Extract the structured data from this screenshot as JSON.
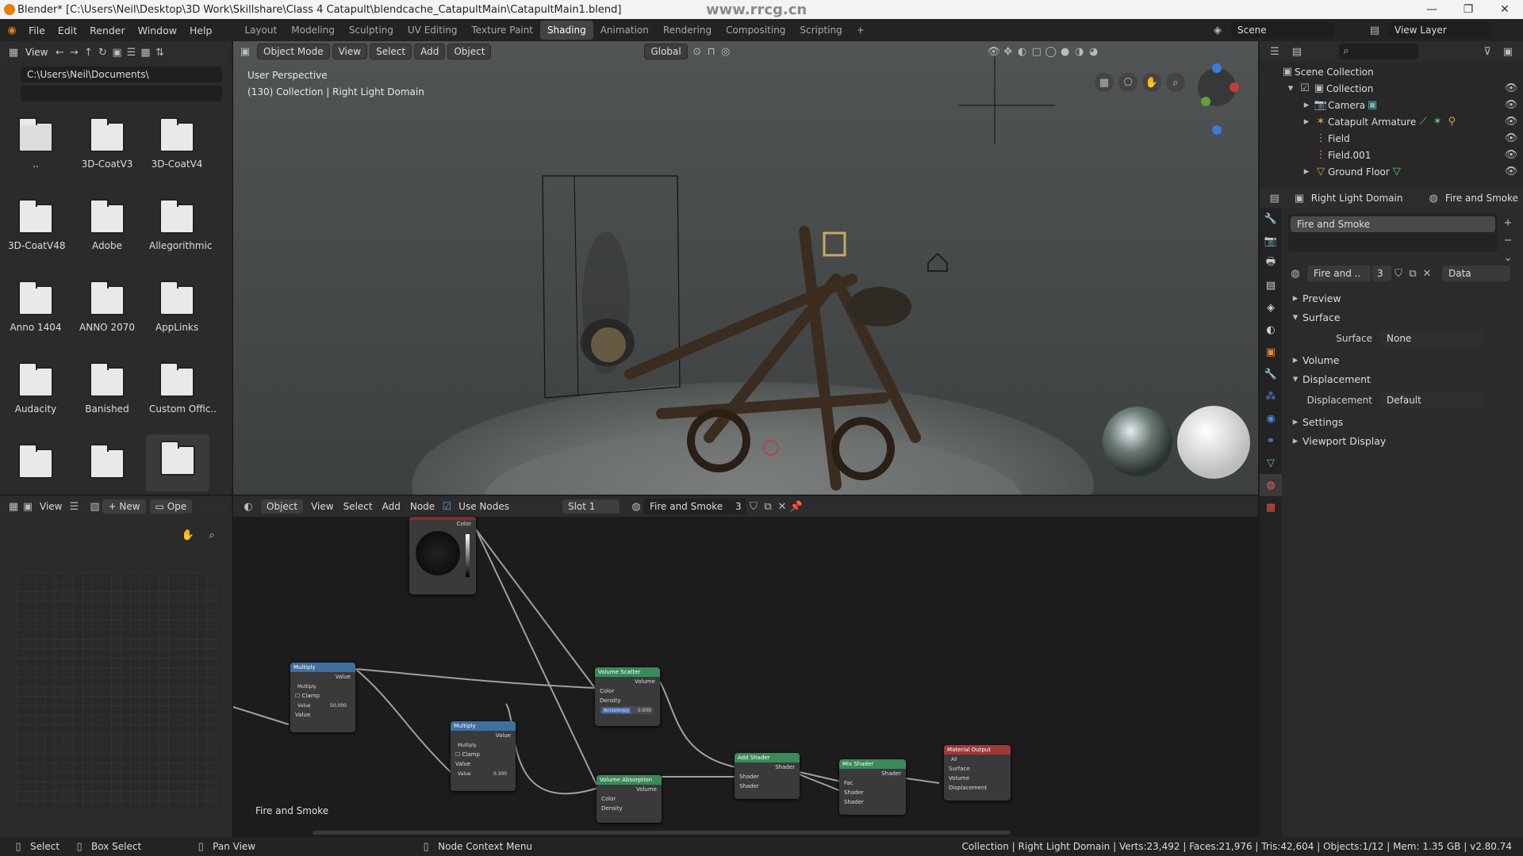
{
  "window": {
    "title": "Blender* [C:\\Users\\Neil\\Desktop\\3D Work\\Skillshare\\Class 4 Catapult\\blendcache_CatapultMain\\CatapultMain1.blend]",
    "watermark": "www.rrcg.cn"
  },
  "menu": {
    "items": [
      "File",
      "Edit",
      "Render",
      "Window",
      "Help"
    ]
  },
  "workspaces": {
    "tabs": [
      "Layout",
      "Modeling",
      "Sculpting",
      "UV Editing",
      "Texture Paint",
      "Shading",
      "Animation",
      "Rendering",
      "Compositing",
      "Scripting"
    ],
    "active": "Shading",
    "add": "+"
  },
  "topright": {
    "scene": "Scene",
    "view_layer": "View Layer"
  },
  "filebrowser": {
    "view": "View",
    "path": "C:\\Users\\Neil\\Documents\\",
    "folders": [
      "..",
      "3D-CoatV3",
      "3D-CoatV4",
      "3D-CoatV48",
      "Adobe",
      "Allegorithmic",
      "Anno 1404",
      "ANNO 2070",
      "AppLinks",
      "Audacity",
      "Banished",
      "Custom Offic..",
      "",
      "",
      ""
    ]
  },
  "viewport": {
    "mode": "Object Mode",
    "menus": [
      "View",
      "Select",
      "Add",
      "Object"
    ],
    "transform": "Global",
    "info_line1": "User Perspective",
    "info_line2": "(130) Collection | Right Light Domain"
  },
  "outliner": {
    "root": "Scene Collection",
    "items": [
      {
        "name": "Collection",
        "indent": 1
      },
      {
        "name": "Camera",
        "indent": 2
      },
      {
        "name": "Catapult Armature",
        "indent": 2
      },
      {
        "name": "Field",
        "indent": 2
      },
      {
        "name": "Field.001",
        "indent": 2
      },
      {
        "name": "Ground Floor",
        "indent": 2
      }
    ]
  },
  "properties": {
    "object": "Right Light Domain",
    "material": "Fire and Smoke",
    "slot_name": "Fire and Smoke",
    "mat_short": "Fire and ..",
    "users": "3",
    "data": "Data",
    "sections": {
      "preview": "Preview",
      "surface": "Surface",
      "volume": "Volume",
      "displacement": "Displacement",
      "settings": "Settings",
      "viewport_display": "Viewport Display"
    },
    "surface_label": "Surface",
    "surface_value": "None",
    "displacement_label": "Displacement",
    "displacement_value": "Default"
  },
  "imageeditor": {
    "view": "View",
    "new": "New",
    "open": "Ope"
  },
  "nodeeditor": {
    "object": "Object",
    "menus": [
      "View",
      "Select",
      "Add",
      "Node"
    ],
    "use_nodes": "Use Nodes",
    "slot": "Slot 1",
    "material": "Fire and Smoke",
    "users": "3",
    "label": "Fire and Smoke",
    "nodes": {
      "multiply1": {
        "title": "Multiply",
        "out": "Value",
        "op": "Multiply",
        "clamp": "Clamp",
        "value": "Value",
        "value_num": "50.000",
        "in": "Value"
      },
      "multiply2": {
        "title": "Multiply",
        "out": "Value",
        "op": "Multiply",
        "clamp": "Clamp",
        "value": "Value",
        "value_num": "0.300",
        "in": "Value"
      },
      "color": {
        "title": "Color"
      },
      "scatter": {
        "title": "Volume Scatter",
        "out": "Volume",
        "color": "Color",
        "density": "Density",
        "aniso": "Anisotropy",
        "aniso_num": "0.000"
      },
      "absorption": {
        "title": "Volume Absorption",
        "out": "Volume",
        "color": "Color",
        "density": "Density"
      },
      "add": {
        "title": "Add Shader",
        "out": "Shader",
        "s1": "Shader",
        "s2": "Shader"
      },
      "mix": {
        "title": "Mix Shader",
        "out": "Shader",
        "fac": "Fac",
        "s1": "Shader",
        "s2": "Shader"
      },
      "output": {
        "title": "Material Output",
        "target": "All",
        "surface": "Surface",
        "volume": "Volume",
        "displacement": "Displacement"
      }
    }
  },
  "status": {
    "select": "Select",
    "box_select": "Box Select",
    "pan_view": "Pan View",
    "context": "Node Context Menu",
    "stats": "Collection | Right Light Domain | Verts:23,492 | Faces:21,976 | Tris:42,604 | Objects:1/12 | Mem: 1.35 GB | v2.80.74"
  }
}
